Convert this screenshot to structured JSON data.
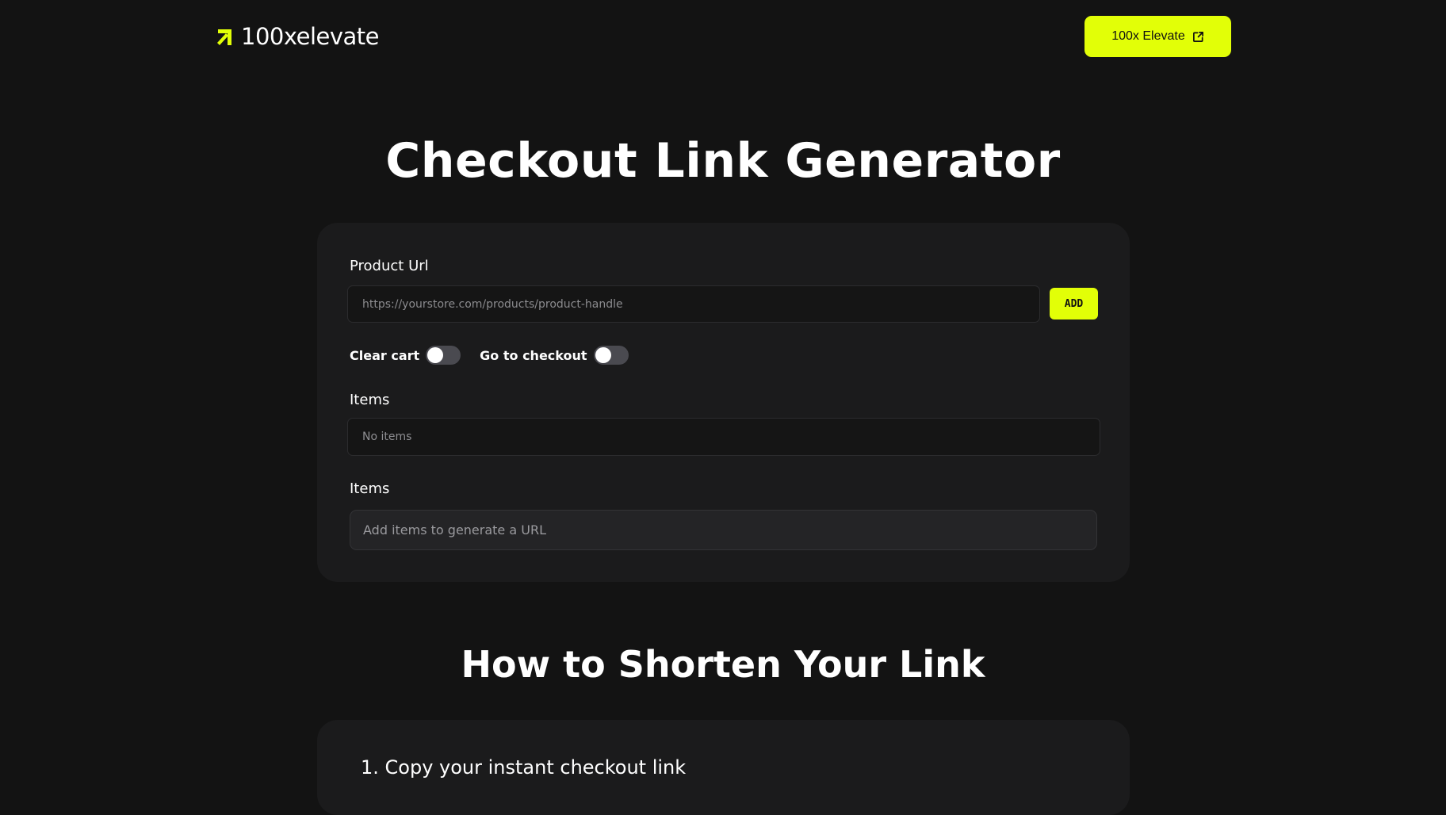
{
  "header": {
    "logo_text": "100xelevate",
    "logo_icon": "arrow-up-right-logo-icon",
    "cta_label": "100x Elevate",
    "cta_icon": "external-link-icon",
    "accent_color": "#e2ff07"
  },
  "page": {
    "title": "Checkout Link Generator"
  },
  "form": {
    "product_url_label": "Product Url",
    "product_url_placeholder": "https://yourstore.com/products/product-handle",
    "product_url_value": "",
    "add_label": "ADD",
    "clear_cart_label": "Clear cart",
    "clear_cart_on": false,
    "go_to_checkout_label": "Go to checkout",
    "go_to_checkout_on": false,
    "items_label": "Items",
    "items_empty_text": "No items",
    "url_label": "Items",
    "url_placeholder_text": "Add items to generate a URL"
  },
  "howto": {
    "title": "How to Shorten Your Link",
    "steps": [
      "1. Copy your instant checkout link"
    ]
  }
}
